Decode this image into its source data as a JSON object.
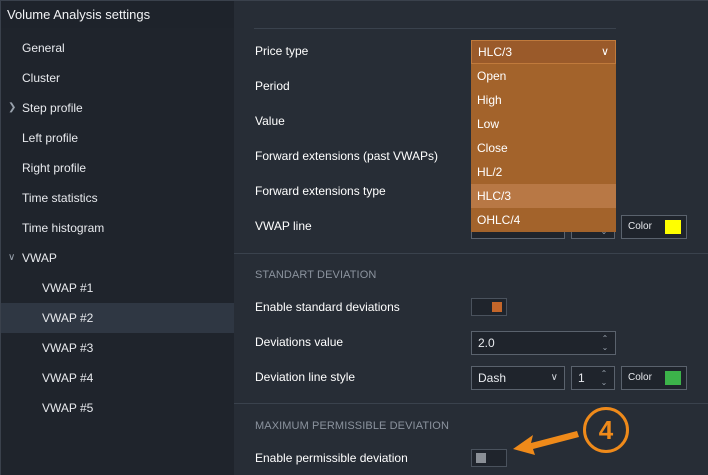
{
  "window": {
    "title": "Volume Analysis settings",
    "close_icon": "close-icon"
  },
  "sidebar": {
    "items": [
      {
        "label": "General"
      },
      {
        "label": "Cluster"
      },
      {
        "label": "Step profile"
      },
      {
        "label": "Left profile"
      },
      {
        "label": "Right profile"
      },
      {
        "label": "Time statistics"
      },
      {
        "label": "Time histogram"
      },
      {
        "label": "VWAP"
      },
      {
        "label": "VWAP #1"
      },
      {
        "label": "VWAP #2"
      },
      {
        "label": "VWAP #3"
      },
      {
        "label": "VWAP #4"
      },
      {
        "label": "VWAP #5"
      }
    ],
    "selected": "VWAP #2"
  },
  "settings": {
    "price_type": {
      "label": "Price type",
      "value": "HLC/3"
    },
    "period": {
      "label": "Period"
    },
    "value": {
      "label": "Value"
    },
    "forward_ext": {
      "label": "Forward extensions (past VWAPs)"
    },
    "forward_ext_type": {
      "label": "Forward extensions type"
    },
    "vwap_line": {
      "label": "VWAP line",
      "color_label": "Color",
      "color": "#ffff00"
    }
  },
  "dropdown": {
    "options": [
      "Open",
      "High",
      "Low",
      "Close",
      "HL/2",
      "HLC/3",
      "OHLC/4"
    ],
    "highlighted": "HLC/3"
  },
  "standard_deviation": {
    "section_title": "STANDART DEVIATION",
    "enable_label": "Enable standard deviations",
    "enable_state": "on",
    "deviations_label": "Deviations value",
    "deviations_value": "2.0",
    "line_style_label": "Deviation line style",
    "line_style_value": "Dash",
    "line_width": "1",
    "color_label": "Color",
    "color": "#3cb34a"
  },
  "max_deviation": {
    "section_title": "MAXIMUM PERMISSIBLE DEVIATION",
    "enable_label": "Enable permissible deviation",
    "enable_state": "off"
  },
  "annotation": {
    "number": "4",
    "color": "#ef8a1a"
  },
  "colors": {
    "accent": "#c4662a",
    "dropdown_bg": "#a3632b",
    "dropdown_active": "#b87845"
  }
}
